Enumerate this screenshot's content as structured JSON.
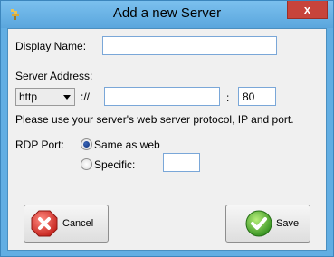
{
  "window": {
    "title": "Add a new Server",
    "close_glyph": "x"
  },
  "form": {
    "display_name": {
      "label": "Display Name:",
      "value": ""
    },
    "server_address": {
      "label": "Server Address:",
      "protocol": "http",
      "separator": "://",
      "host": "",
      "port_separator": ":",
      "port": "80"
    },
    "hint": "Please use your server's web server protocol, IP and port.",
    "rdp_port": {
      "label": "RDP Port:",
      "options": [
        {
          "label": "Same as web",
          "checked": true
        },
        {
          "label": "Specific:",
          "checked": false
        }
      ],
      "specific_value": ""
    }
  },
  "buttons": {
    "cancel": "Cancel",
    "save": "Save"
  },
  "colors": {
    "frame": "#62aee3",
    "close": "#c7443b",
    "client": "#f0f0f0",
    "cancel_icon": "#e03a33",
    "save_icon": "#4caf2a"
  }
}
